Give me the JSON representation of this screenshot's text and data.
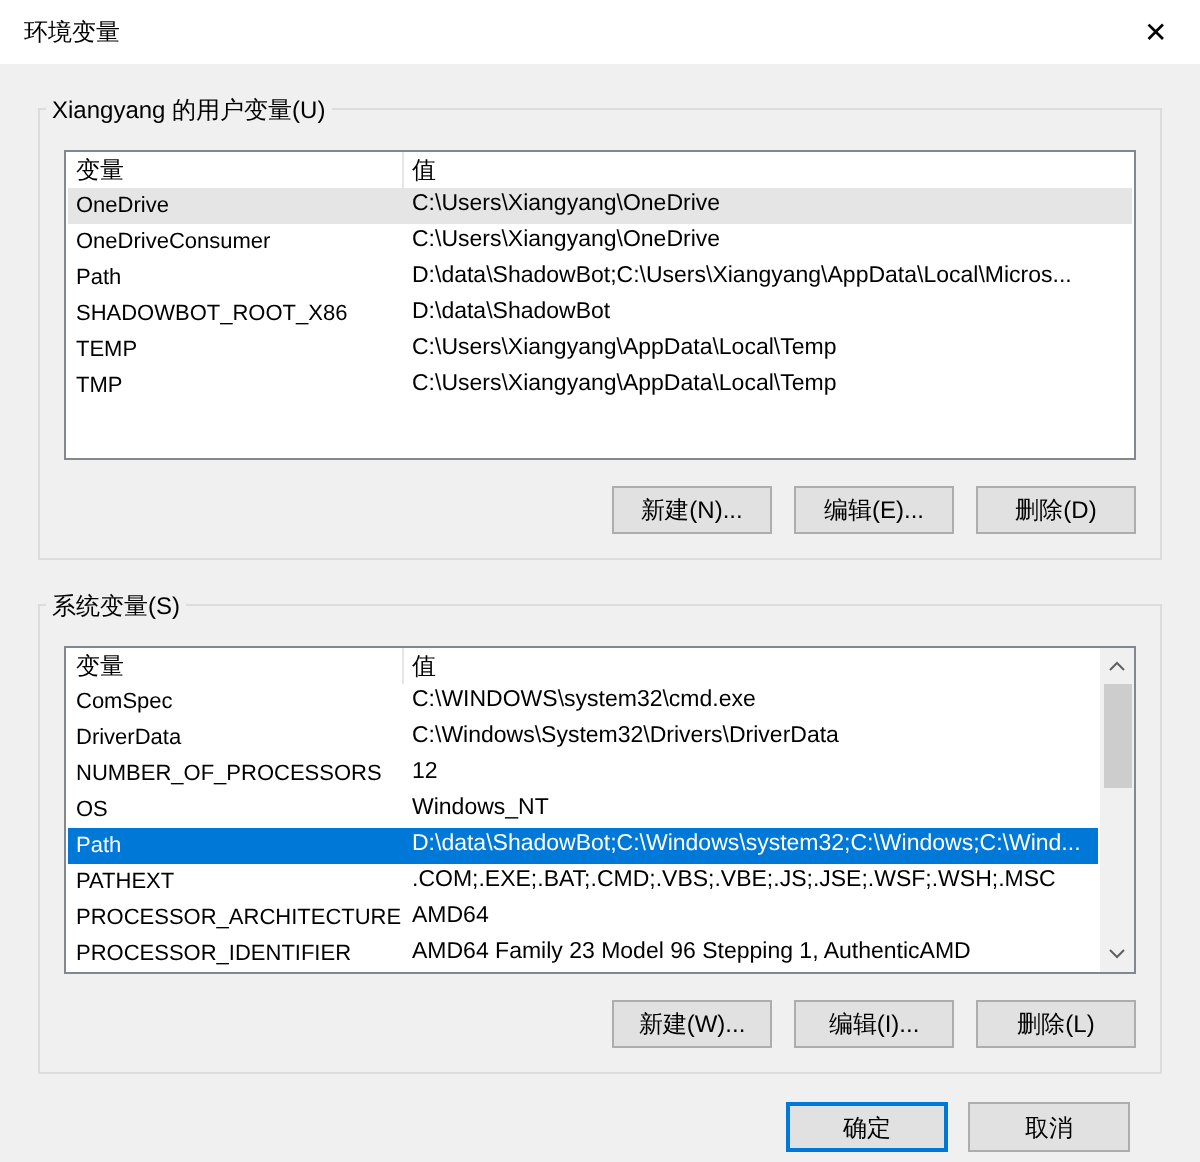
{
  "window": {
    "title": "环境变量",
    "close": "✕"
  },
  "user_variables": {
    "title": "Xiangyang 的用户变量(U)",
    "focused": false,
    "columns": [
      "变量",
      "值"
    ],
    "rows": [
      {
        "name": "OneDrive",
        "value": "C:\\Users\\Xiangyang\\OneDrive",
        "selected": true
      },
      {
        "name": "OneDriveConsumer",
        "value": "C:\\Users\\Xiangyang\\OneDrive",
        "selected": false
      },
      {
        "name": "Path",
        "value": "D:\\data\\ShadowBot;C:\\Users\\Xiangyang\\AppData\\Local\\Micros...",
        "selected": false
      },
      {
        "name": "SHADOWBOT_ROOT_X86",
        "value": "D:\\data\\ShadowBot",
        "selected": false
      },
      {
        "name": "TEMP",
        "value": "C:\\Users\\Xiangyang\\AppData\\Local\\Temp",
        "selected": false
      },
      {
        "name": "TMP",
        "value": "C:\\Users\\Xiangyang\\AppData\\Local\\Temp",
        "selected": false
      }
    ],
    "buttons": [
      "新建(N)...",
      "编辑(E)...",
      "删除(D)"
    ]
  },
  "system_variables": {
    "title": "系统变量(S)",
    "focused": true,
    "columns": [
      "变量",
      "值"
    ],
    "rows": [
      {
        "name": "ComSpec",
        "value": "C:\\WINDOWS\\system32\\cmd.exe",
        "selected": false
      },
      {
        "name": "DriverData",
        "value": "C:\\Windows\\System32\\Drivers\\DriverData",
        "selected": false
      },
      {
        "name": "NUMBER_OF_PROCESSORS",
        "value": "12",
        "selected": false
      },
      {
        "name": "OS",
        "value": "Windows_NT",
        "selected": false
      },
      {
        "name": "Path",
        "value": "D:\\data\\ShadowBot;C:\\Windows\\system32;C:\\Windows;C:\\Wind...",
        "selected": true
      },
      {
        "name": "PATHEXT",
        "value": ".COM;.EXE;.BAT;.CMD;.VBS;.VBE;.JS;.JSE;.WSF;.WSH;.MSC",
        "selected": false
      },
      {
        "name": "PROCESSOR_ARCHITECTURE",
        "value": "AMD64",
        "selected": false
      },
      {
        "name": "PROCESSOR_IDENTIFIER",
        "value": "AMD64 Family 23 Model 96 Stepping 1, AuthenticAMD",
        "selected": false
      }
    ],
    "buttons": [
      "新建(W)...",
      "编辑(I)...",
      "删除(L)"
    ]
  },
  "footer_buttons": [
    {
      "label": "确定",
      "default": true
    },
    {
      "label": "取消",
      "default": false
    }
  ]
}
